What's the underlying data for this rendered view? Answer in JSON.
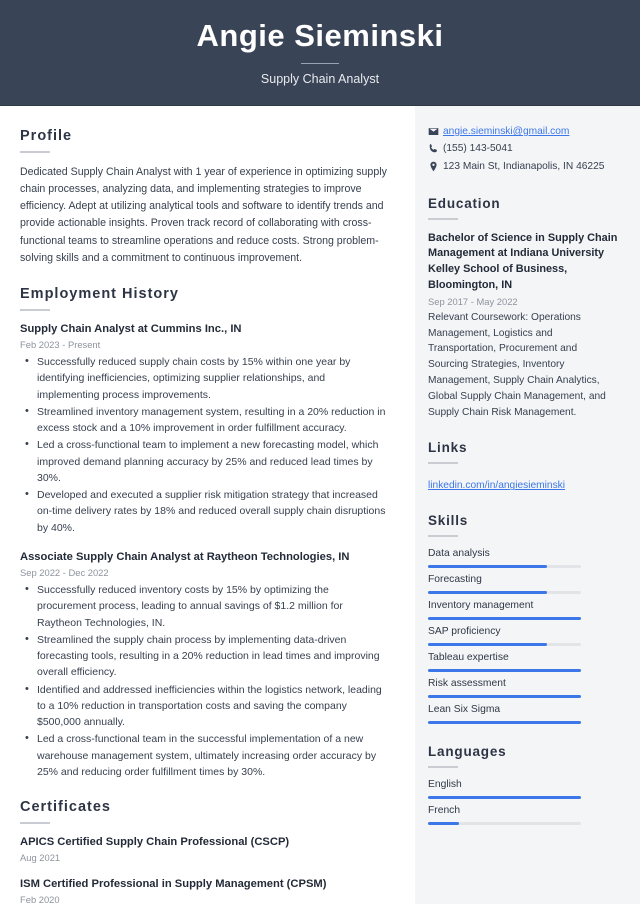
{
  "header": {
    "name": "Angie Sieminski",
    "job_title": "Supply Chain Analyst"
  },
  "main": {
    "profile": {
      "heading": "Profile",
      "text": "Dedicated Supply Chain Analyst with 1 year of experience in optimizing supply chain processes, analyzing data, and implementing strategies to improve efficiency. Adept at utilizing analytical tools and software to identify trends and provide actionable insights. Proven track record of collaborating with cross-functional teams to streamline operations and reduce costs. Strong problem-solving skills and a commitment to continuous improvement."
    },
    "employment": {
      "heading": "Employment History",
      "jobs": [
        {
          "title": "Supply Chain Analyst at Cummins Inc., IN",
          "date": "Feb 2023 - Present",
          "bullets": [
            "Successfully reduced supply chain costs by 15% within one year by identifying inefficiencies, optimizing supplier relationships, and implementing process improvements.",
            "Streamlined inventory management system, resulting in a 20% reduction in excess stock and a 10% improvement in order fulfillment accuracy.",
            "Led a cross-functional team to implement a new forecasting model, which improved demand planning accuracy by 25% and reduced lead times by 30%.",
            "Developed and executed a supplier risk mitigation strategy that increased on-time delivery rates by 18% and reduced overall supply chain disruptions by 40%."
          ]
        },
        {
          "title": "Associate Supply Chain Analyst at Raytheon Technologies, IN",
          "date": "Sep 2022 - Dec 2022",
          "bullets": [
            "Successfully reduced inventory costs by 15% by optimizing the procurement process, leading to annual savings of $1.2 million for Raytheon Technologies, IN.",
            "Streamlined the supply chain process by implementing data-driven forecasting tools, resulting in a 20% reduction in lead times and improving overall efficiency.",
            "Identified and addressed inefficiencies within the logistics network, leading to a 10% reduction in transportation costs and saving the company $500,000 annually.",
            "Led a cross-functional team in the successful implementation of a new warehouse management system, ultimately increasing order accuracy by 25% and reducing order fulfillment times by 30%."
          ]
        }
      ]
    },
    "certificates": {
      "heading": "Certificates",
      "items": [
        {
          "title": "APICS Certified Supply Chain Professional (CSCP)",
          "date": "Aug 2021"
        },
        {
          "title": "ISM Certified Professional in Supply Management (CPSM)",
          "date": "Feb 2020"
        }
      ]
    }
  },
  "sidebar": {
    "contact": [
      {
        "icon": "envelope-icon",
        "text": "angie.sieminski@gmail.com",
        "is_link": true
      },
      {
        "icon": "phone-icon",
        "text": "(155) 143-5041",
        "is_link": false
      },
      {
        "icon": "location-pin-icon",
        "text": "123 Main St, Indianapolis, IN 46225",
        "is_link": false
      }
    ],
    "education": {
      "heading": "Education",
      "degree": "Bachelor of Science in Supply Chain Management at Indiana University Kelley School of Business, Bloomington, IN",
      "date": "Sep 2017 - May 2022",
      "coursework": "Relevant Coursework: Operations Management, Logistics and Transportation, Procurement and Sourcing Strategies, Inventory Management, Supply Chain Analytics, Global Supply Chain Management, and Supply Chain Risk Management."
    },
    "links": {
      "heading": "Links",
      "items": [
        {
          "label": "linkedin.com/in/angiesieminski"
        }
      ]
    },
    "skills": {
      "heading": "Skills",
      "items": [
        {
          "label": "Data analysis",
          "level": 78
        },
        {
          "label": "Forecasting",
          "level": 78
        },
        {
          "label": "Inventory management",
          "level": 100
        },
        {
          "label": "SAP proficiency",
          "level": 78
        },
        {
          "label": "Tableau expertise",
          "level": 100
        },
        {
          "label": "Risk assessment",
          "level": 100
        },
        {
          "label": "Lean Six Sigma",
          "level": 100
        }
      ]
    },
    "languages": {
      "heading": "Languages",
      "items": [
        {
          "label": "English",
          "level": 100
        },
        {
          "label": "French",
          "level": 20
        }
      ]
    }
  },
  "colors": {
    "header_bg": "#3a4457",
    "sidebar_bg": "#f4f5f7",
    "accent_blue": "#3b77e8",
    "text_dark": "#232b38",
    "text_muted": "#8d939e"
  }
}
